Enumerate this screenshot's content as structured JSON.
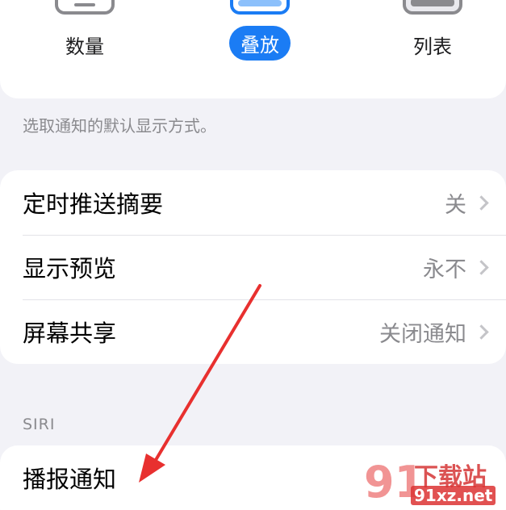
{
  "display_style": {
    "options": [
      {
        "label": "数量",
        "selected": false
      },
      {
        "label": "叠放",
        "selected": true
      },
      {
        "label": "列表",
        "selected": false
      }
    ],
    "footer": "选取通知的默认显示方式。"
  },
  "group_main": {
    "rows": [
      {
        "title": "定时推送摘要",
        "value": "关"
      },
      {
        "title": "显示预览",
        "value": "永不"
      },
      {
        "title": "屏幕共享",
        "value": "关闭通知"
      }
    ]
  },
  "siri": {
    "header": "SIRI",
    "rows": [
      {
        "title": "播报通知"
      }
    ]
  },
  "watermark": {
    "number": "91",
    "name": "下载站",
    "url": "91xz.net"
  },
  "colors": {
    "accent": "#1b7cf4",
    "annotation_arrow": "#e8302f"
  }
}
